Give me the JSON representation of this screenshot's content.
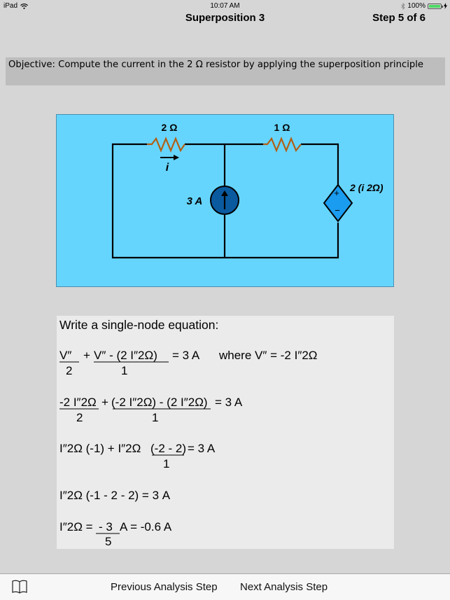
{
  "status_bar": {
    "device": "iPad",
    "time": "10:07 AM",
    "battery": "100%",
    "battery_level": 1.0
  },
  "nav": {
    "title": "Superposition 3",
    "step": "Step  5 of  6"
  },
  "objective": "Objective: Compute the current in the 2 Ω resistor by applying the superposition principle",
  "circuit": {
    "r1_label": "2 Ω",
    "r2_label": "1 Ω",
    "current_label": "i",
    "source_label": "3 A",
    "dep_source_label": "2 (i 2Ω)",
    "dep_plus": "+",
    "dep_minus": "−",
    "colors": {
      "background": "#66d5fd",
      "resistor": "#b05f14",
      "source_fill": "#0a5aa0",
      "dep_source_fill": "#1a9cf0"
    }
  },
  "equations": {
    "heading": "Write a single-node equation:",
    "eq1": {
      "num1": "V″",
      "den1": "2",
      "plus": "+",
      "num2": "V″  - (2 I″2Ω)",
      "den2": "1",
      "rhs": "= 3 A",
      "where": "where V″  = -2 I″2Ω"
    },
    "eq2": {
      "num1": "-2 I″2Ω",
      "den1": "2",
      "plus": "+",
      "num2": "(-2 I″2Ω) - (2 I″2Ω)",
      "den2": "1",
      "rhs": "= 3 A"
    },
    "eq3": {
      "lhs": "I″2Ω (-1) + I″2Ω",
      "num": "(-2 - 2)",
      "den": "1",
      "rhs": "= 3 A"
    },
    "eq4": "I″2Ω (-1 - 2 - 2) = 3 A",
    "eq5": {
      "lhs": "I″2Ω =",
      "num": "- 3",
      "den": "5",
      "rhs": "A = -0.6 A"
    }
  },
  "toolbar": {
    "book_icon": "book-icon",
    "prev_label": "Previous Analysis Step",
    "next_label": "Next Analysis Step"
  }
}
